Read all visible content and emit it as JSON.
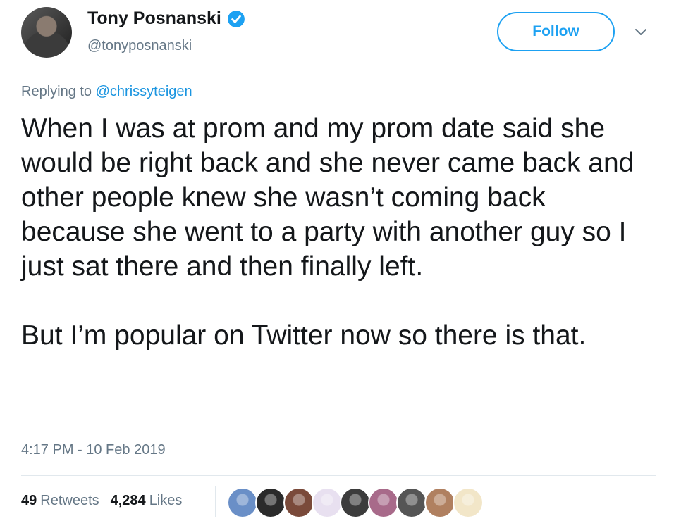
{
  "user": {
    "name": "Tony Posnanski",
    "handle": "@tonyposnanski",
    "verified": true
  },
  "follow_label": "Follow",
  "reply": {
    "prefix": "Replying to ",
    "mention": "@chrissyteigen"
  },
  "tweet": {
    "text": "When I was at prom and my prom date said she would be right back and she never came back and other people knew she wasn’t coming back because she went to a party with another guy so I just sat there and then finally left.\n\nBut I’m popular on Twitter now so there is that."
  },
  "timestamp": "4:17 PM - 10 Feb 2019",
  "stats": {
    "retweets_count": "49",
    "retweets_label": "Retweets",
    "likes_count": "4,284",
    "likes_label": "Likes"
  },
  "colors": {
    "accent": "#1da1f2",
    "muted": "#657786",
    "text": "#14171a"
  },
  "liker_avatars": [
    {
      "name": "liker-avatar-1",
      "bg": "#6a8fc7"
    },
    {
      "name": "liker-avatar-2",
      "bg": "#2b2b2b"
    },
    {
      "name": "liker-avatar-3",
      "bg": "#7a4a3a"
    },
    {
      "name": "liker-avatar-4",
      "bg": "#e8e0f0"
    },
    {
      "name": "liker-avatar-5",
      "bg": "#3c3c3c"
    },
    {
      "name": "liker-avatar-6",
      "bg": "#a86a8a"
    },
    {
      "name": "liker-avatar-7",
      "bg": "#555555"
    },
    {
      "name": "liker-avatar-8",
      "bg": "#b08060"
    },
    {
      "name": "liker-avatar-9",
      "bg": "#f2e6c8"
    }
  ]
}
